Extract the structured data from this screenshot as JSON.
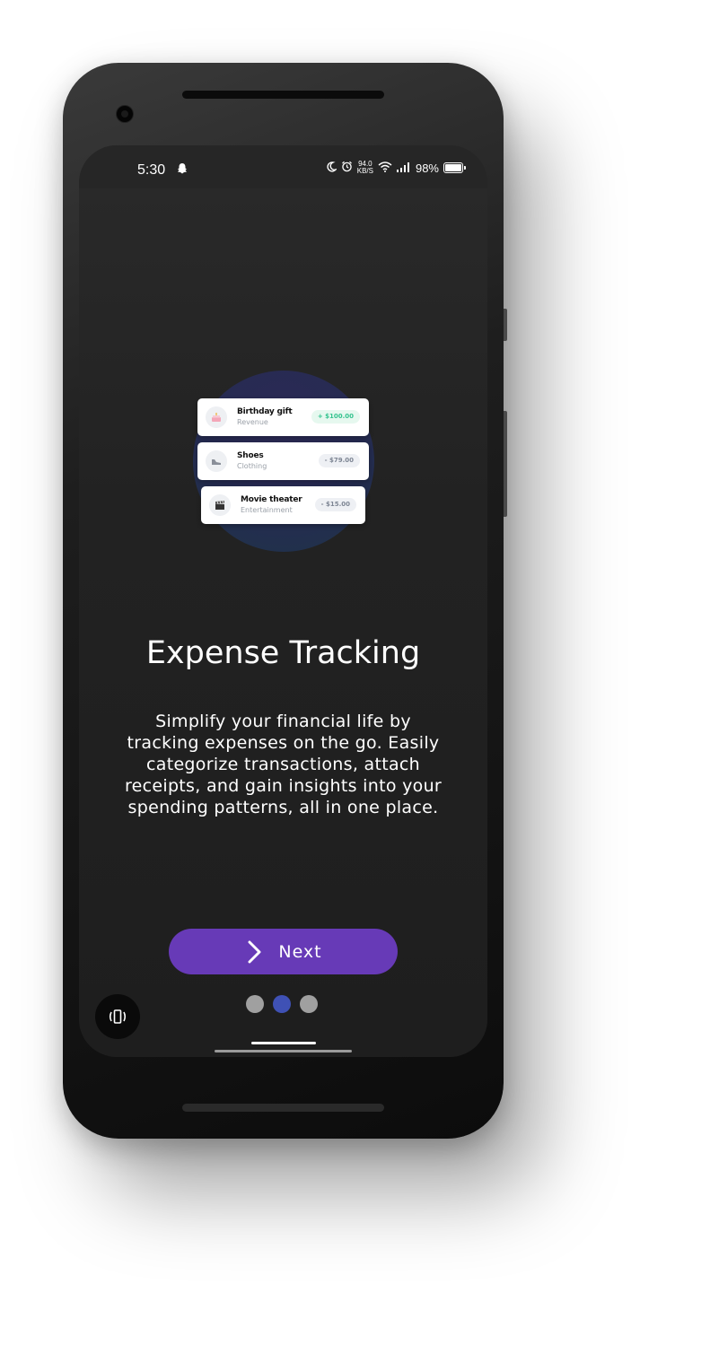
{
  "status_bar": {
    "time": "5:30",
    "speed_value": "94.0",
    "speed_unit": "KB/S",
    "battery": "98%"
  },
  "illustration": {
    "transactions": [
      {
        "name": "Birthday gift",
        "category": "Revenue",
        "amount": "+ $100.00",
        "icon": "cake-icon"
      },
      {
        "name": "Shoes",
        "category": "Clothing",
        "amount": "- $79.00",
        "icon": "shoe-icon"
      },
      {
        "name": "Movie theater",
        "category": "Entertainment",
        "amount": "- $15.00",
        "icon": "clapperboard-icon"
      }
    ]
  },
  "onboarding": {
    "title": "Expense Tracking",
    "description": "Simplify your financial life by tracking expenses on the go. Easily categorize transactions, attach receipts, and gain insights into your spending patterns, all in one place.",
    "next_label": "Next",
    "page_count": 3,
    "active_page": 2
  },
  "colors": {
    "accent": "#673ab7",
    "active_dot": "#3f51b5",
    "inactive_dot": "#a0a0a0",
    "positive_amount": "#34c38f"
  }
}
